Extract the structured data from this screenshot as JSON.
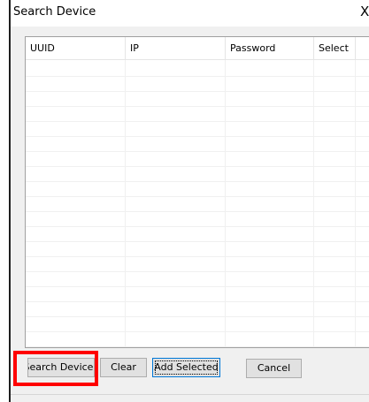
{
  "window": {
    "title": "Search Device",
    "close_glyph": "X"
  },
  "table": {
    "columns": [
      "UUID",
      "IP",
      "Password",
      "Select"
    ],
    "rows": []
  },
  "buttons": {
    "search": "Search Device",
    "clear": "Clear",
    "add_selected": "Add Selected",
    "cancel": "Cancel"
  },
  "colors": {
    "highlight": "#ff0000",
    "focus_border": "#0078d7"
  }
}
